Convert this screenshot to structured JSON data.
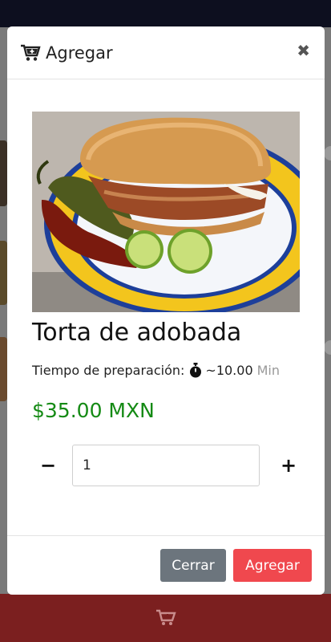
{
  "modal": {
    "title": "Agregar",
    "title_icon": "cart-plus-icon",
    "close_symbol": "✖"
  },
  "product": {
    "image_alt": "Torta de adobada",
    "name": "Torta de adobada",
    "prep_label": "Tiempo de preparación:",
    "prep_icon": "stopwatch-icon",
    "prep_value": "~10.00",
    "prep_unit": "Min",
    "price": "$35.00 MXN"
  },
  "quantity": {
    "minus_symbol": "−",
    "plus_symbol": "+",
    "value": "1"
  },
  "footer": {
    "cancel_label": "Cerrar",
    "add_label": "Agregar"
  },
  "background": {
    "bottom_bar_icon": "cart-icon"
  },
  "colors": {
    "price_green": "#148a14",
    "add_button": "#f0484e",
    "cancel_button": "#6c757d",
    "bottom_bar": "#7b1f1f"
  }
}
